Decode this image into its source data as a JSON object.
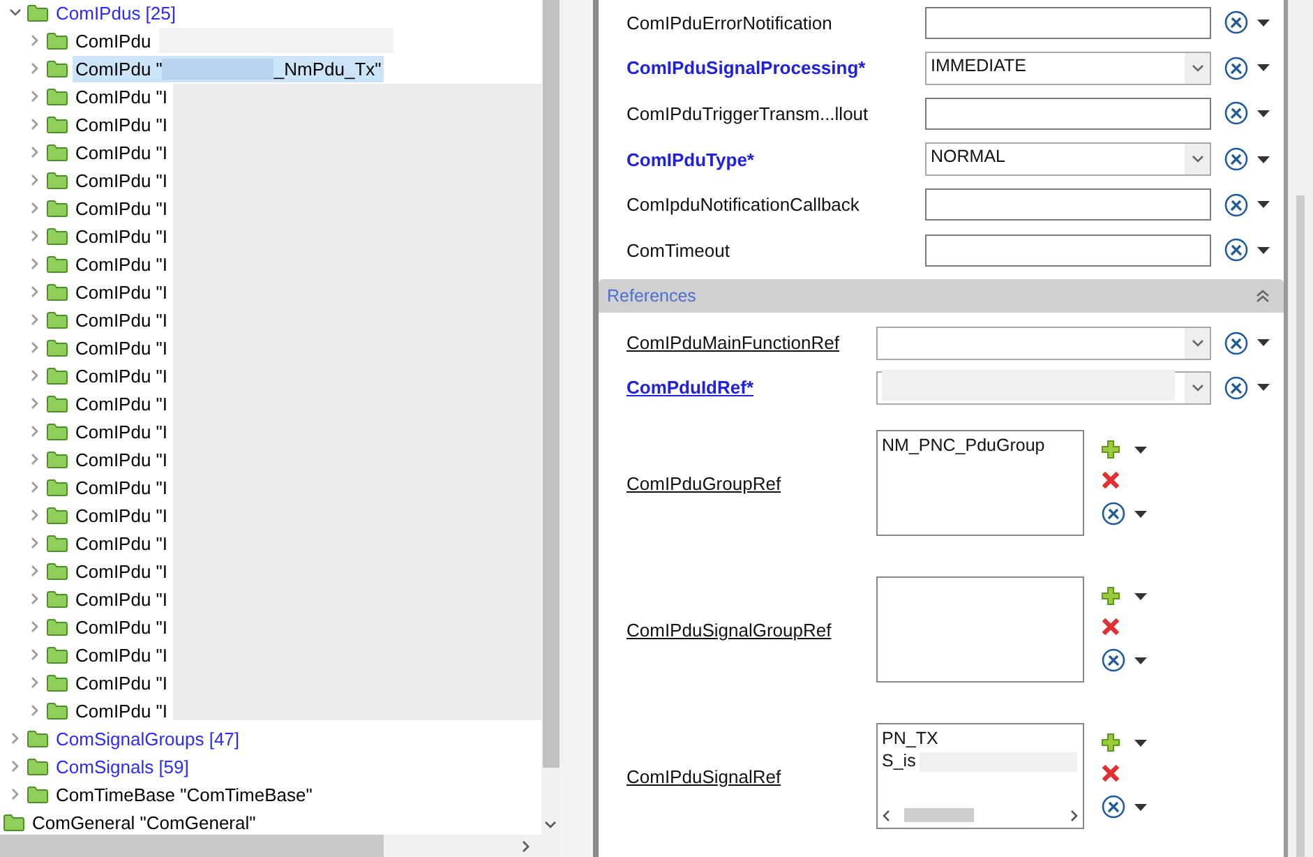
{
  "tree": [
    {
      "kind": "group",
      "label": "ComIPdus [25]",
      "expanded": true,
      "children": [
        {
          "kind": "node",
          "label": "ComIPdu",
          "selected": false
        },
        {
          "kind": "node",
          "label": "ComIPdu \"",
          "tail": "_NmPdu_Tx\"",
          "selected": true
        },
        {
          "kind": "node",
          "label": "ComIPdu \"I",
          "selected": false
        },
        {
          "kind": "node",
          "label": "ComIPdu \"I",
          "selected": false
        },
        {
          "kind": "node",
          "label": "ComIPdu \"I",
          "selected": false
        },
        {
          "kind": "node",
          "label": "ComIPdu \"I",
          "selected": false
        },
        {
          "kind": "node",
          "label": "ComIPdu \"I",
          "selected": false
        },
        {
          "kind": "node",
          "label": "ComIPdu \"I",
          "selected": false
        },
        {
          "kind": "node",
          "label": "ComIPdu \"I",
          "selected": false
        },
        {
          "kind": "node",
          "label": "ComIPdu \"I",
          "selected": false
        },
        {
          "kind": "node",
          "label": "ComIPdu \"I",
          "selected": false
        },
        {
          "kind": "node",
          "label": "ComIPdu \"I",
          "selected": false
        },
        {
          "kind": "node",
          "label": "ComIPdu \"I",
          "selected": false
        },
        {
          "kind": "node",
          "label": "ComIPdu \"I",
          "selected": false
        },
        {
          "kind": "node",
          "label": "ComIPdu \"I",
          "selected": false
        },
        {
          "kind": "node",
          "label": "ComIPdu \"I",
          "selected": false
        },
        {
          "kind": "node",
          "label": "ComIPdu \"I",
          "selected": false
        },
        {
          "kind": "node",
          "label": "ComIPdu \"I",
          "selected": false
        },
        {
          "kind": "node",
          "label": "ComIPdu \"I",
          "selected": false
        },
        {
          "kind": "node",
          "label": "ComIPdu \"I",
          "selected": false
        },
        {
          "kind": "node",
          "label": "ComIPdu \"I",
          "selected": false
        },
        {
          "kind": "node",
          "label": "ComIPdu \"I",
          "selected": false
        },
        {
          "kind": "node",
          "label": "ComIPdu \"I",
          "selected": false
        },
        {
          "kind": "node",
          "label": "ComIPdu \"I",
          "selected": false
        },
        {
          "kind": "node",
          "label": "ComIPdu \"I",
          "selected": false
        }
      ]
    },
    {
      "kind": "group",
      "label": "ComSignalGroups [47]",
      "expanded": false
    },
    {
      "kind": "group",
      "label": "ComSignals [59]",
      "expanded": false
    },
    {
      "kind": "node",
      "label": "ComTimeBase \"ComTimeBase\"",
      "expanded": false
    },
    {
      "kind": "leaf",
      "label": "ComGeneral \"ComGeneral\""
    }
  ],
  "parameters": [
    {
      "kind": "text",
      "label": "ComIPduErrorNotification",
      "required": false
    },
    {
      "kind": "combo",
      "label": "ComIPduSignalProcessing*",
      "required": true,
      "value": "IMMEDIATE"
    },
    {
      "kind": "text",
      "label": "ComIPduTriggerTransm...llout",
      "required": false
    },
    {
      "kind": "combo",
      "label": "ComIPduType*",
      "required": true,
      "value": "NORMAL"
    },
    {
      "kind": "text",
      "label": "ComIpduNotificationCallback",
      "required": false
    },
    {
      "kind": "text",
      "label": "ComTimeout",
      "required": false
    }
  ],
  "references": {
    "title": "References",
    "expanded": true,
    "rows": [
      {
        "kind": "combo",
        "label": "ComIPduMainFunctionRef",
        "required": false
      },
      {
        "kind": "combo",
        "label": "ComPduIdRef*",
        "required": true,
        "redacted": true
      },
      {
        "kind": "list",
        "label": "ComIPduGroupRef",
        "items": [
          "NM_PNC_PduGroup"
        ]
      },
      {
        "kind": "list",
        "label": "ComIPduSignalGroupRef"
      },
      {
        "kind": "list",
        "label": "ComIPduSignalRef",
        "items": [
          "PN_TX",
          "S_is"
        ],
        "hscroll": true
      }
    ]
  }
}
